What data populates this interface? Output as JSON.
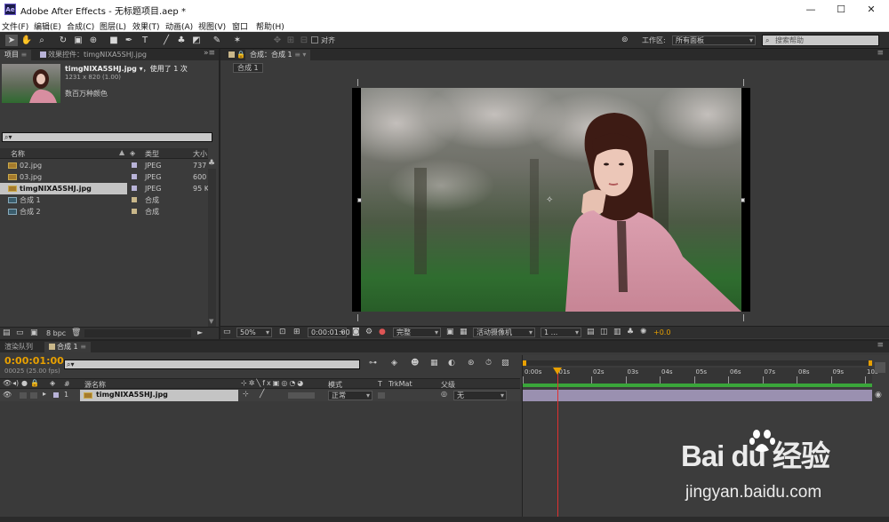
{
  "app": {
    "window_title": "Adobe After Effects - 无标题项目.aep *",
    "logo_text": "Ae",
    "win_minimize": "—",
    "win_maximize": "☐",
    "win_close": "✕"
  },
  "menu": [
    "文件(F)",
    "编辑(E)",
    "合成(C)",
    "图层(L)",
    "效果(T)",
    "动画(A)",
    "视图(V)",
    "窗口",
    "帮助(H)"
  ],
  "toolbar": {
    "align_label": "对齐",
    "workspace_label": "工作区:",
    "workspace_value": "所有面板",
    "search_placeholder": "搜索帮助"
  },
  "project_panel": {
    "tab_project": "项目",
    "tab_effects": "效果控件：timgNIXA5SHJ.jpg",
    "file_name": "timgNIXA5SHJ.jpg ▾",
    "usage": "，使用了 1 次",
    "dimensions": "1231 x 820 (1.00)",
    "color_desc": "数百万种颜色",
    "search_icon_glyph": "⌕▾",
    "columns": {
      "name": "名称",
      "type": "类型",
      "size": "大小"
    },
    "items": [
      {
        "name": "02.jpg",
        "type": "JPEG",
        "size": "737",
        "kind": "file",
        "selected": false
      },
      {
        "name": "03.jpg",
        "type": "JPEG",
        "size": "600",
        "kind": "file",
        "selected": false
      },
      {
        "name": "timgNIXA5SHJ.jpg",
        "type": "JPEG",
        "size": "95 K",
        "kind": "file",
        "selected": true
      },
      {
        "name": "合成 1",
        "type": "合成",
        "size": "",
        "kind": "comp",
        "selected": false
      },
      {
        "name": "合成 2",
        "type": "合成",
        "size": "",
        "kind": "comp",
        "selected": false
      }
    ],
    "bpc": "8 bpc"
  },
  "comp_panel": {
    "tab": "合成：合成 1",
    "breadcrumb": "合成 1",
    "zoom": "50%",
    "timecode": "0:00:01:00",
    "resolution": "完整",
    "camera": "活动摄像机",
    "views": "1 ...",
    "exposure": "+0.0"
  },
  "timeline": {
    "tab_render": "渲染队列",
    "tab_comp": "合成 1",
    "current_time": "0:00:01:00",
    "frame_info": "00025 (25.00 fps)",
    "search_icon_glyph": "⌕▾",
    "columns": {
      "num": "#",
      "source": "源名称",
      "mode": "模式",
      "t": "T",
      "trkmat": "TrkMat",
      "parent": "父级"
    },
    "layers": [
      {
        "num": "1",
        "name": "timgNIXA5SHJ.jpg",
        "mode": "正常",
        "parent": "无"
      }
    ],
    "ruler": [
      "0:00s",
      "01s",
      "02s",
      "03s",
      "04s",
      "05s",
      "06s",
      "07s",
      "08s",
      "09s",
      "10s"
    ],
    "playhead_fraction": 0.1
  },
  "watermark": {
    "line1": "Bai du 经验",
    "line2": "jingyan.baidu.com"
  },
  "colors": {
    "accent_orange": "#e8a000",
    "playhead_red": "#e03030",
    "layer_bar": "#9a90b0",
    "green_bar": "#3aa53a"
  }
}
